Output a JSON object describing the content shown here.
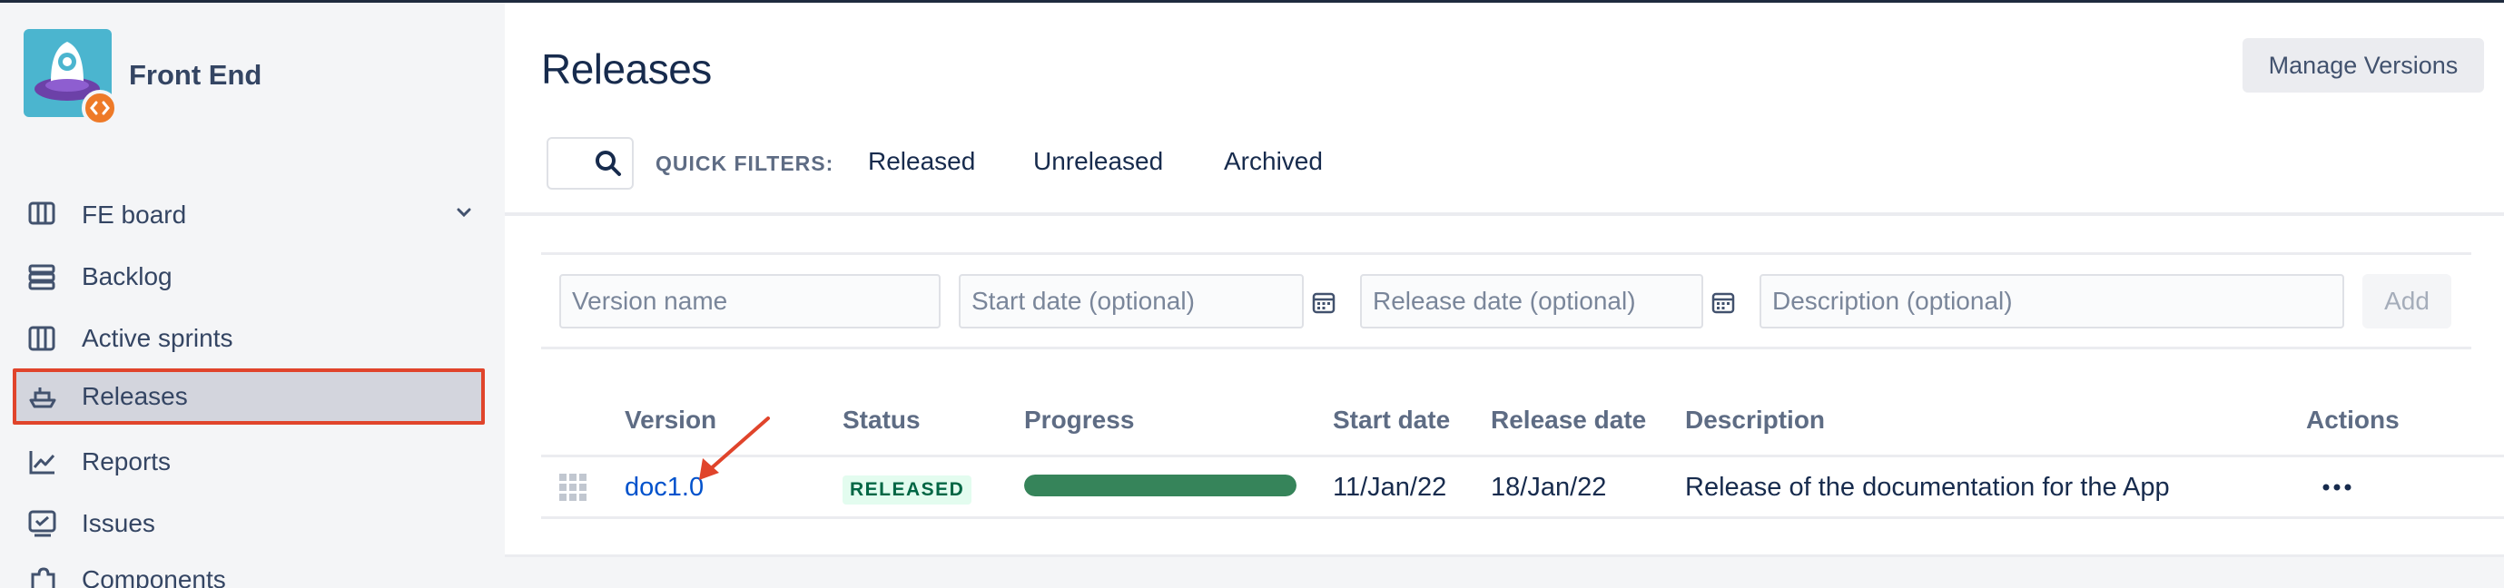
{
  "sidebar": {
    "project_name": "Front End",
    "board_selector": "FE board",
    "items": [
      {
        "label": "Backlog",
        "icon": "backlog-icon"
      },
      {
        "label": "Active sprints",
        "icon": "columns-icon"
      },
      {
        "label": "Releases",
        "icon": "ship-icon",
        "selected": true
      },
      {
        "label": "Reports",
        "icon": "chart-icon"
      },
      {
        "label": "Issues",
        "icon": "issues-icon"
      },
      {
        "label": "Components",
        "icon": "puzzle-icon"
      }
    ]
  },
  "header": {
    "title": "Releases",
    "manage_button": "Manage Versions"
  },
  "filters": {
    "search_placeholder": "",
    "quick_filters_label": "QUICK FILTERS:",
    "options": [
      "Released",
      "Unreleased",
      "Archived"
    ]
  },
  "create_form": {
    "version_placeholder": "Version name",
    "start_placeholder": "Start date (optional)",
    "release_placeholder": "Release date (optional)",
    "description_placeholder": "Description (optional)",
    "add_label": "Add"
  },
  "table": {
    "columns": [
      "Version",
      "Status",
      "Progress",
      "Start date",
      "Release date",
      "Description",
      "Actions"
    ],
    "rows": [
      {
        "version": "doc1.0",
        "status": "RELEASED",
        "progress": 1.0,
        "start_date": "11/Jan/22",
        "release_date": "18/Jan/22",
        "description": "Release of the documentation for the App"
      }
    ]
  },
  "colors": {
    "accent_link": "#0052cc",
    "released_green": "#36845a",
    "highlight_border": "#e0442b"
  }
}
